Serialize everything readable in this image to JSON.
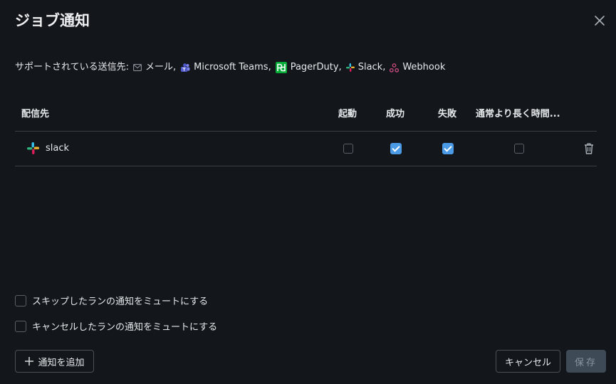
{
  "dialog": {
    "title": "ジョブ通知"
  },
  "supported": {
    "label": "サポートされている送信先:",
    "destinations": [
      {
        "label": "メール,",
        "icon": "mail-icon"
      },
      {
        "label": "Microsoft Teams,",
        "icon": "teams-icon"
      },
      {
        "label": "PagerDuty,",
        "icon": "pagerduty-icon"
      },
      {
        "label": "Slack,",
        "icon": "slack-icon"
      },
      {
        "label": "Webhook",
        "icon": "webhook-icon"
      }
    ]
  },
  "table": {
    "headers": {
      "destination": "配信先",
      "start": "起動",
      "success": "成功",
      "failure": "失敗",
      "duration": "通常より長く時間..."
    },
    "rows": [
      {
        "name": "slack",
        "icon": "slack-icon",
        "start": false,
        "success": true,
        "failure": true,
        "duration": false
      }
    ]
  },
  "options": {
    "mute_skipped": "スキップしたランの通知をミュートにする",
    "mute_skipped_checked": false,
    "mute_cancelled": "キャンセルしたランの通知をミュートにする",
    "mute_cancelled_checked": false
  },
  "footer": {
    "add_label": "通知を追加",
    "cancel_label": "キャンセル",
    "save_label": "保存"
  },
  "colors": {
    "background": "#13171b",
    "accent": "#4a9ae6",
    "border": "#3a3f45",
    "save_disabled": "#3e4a56"
  }
}
